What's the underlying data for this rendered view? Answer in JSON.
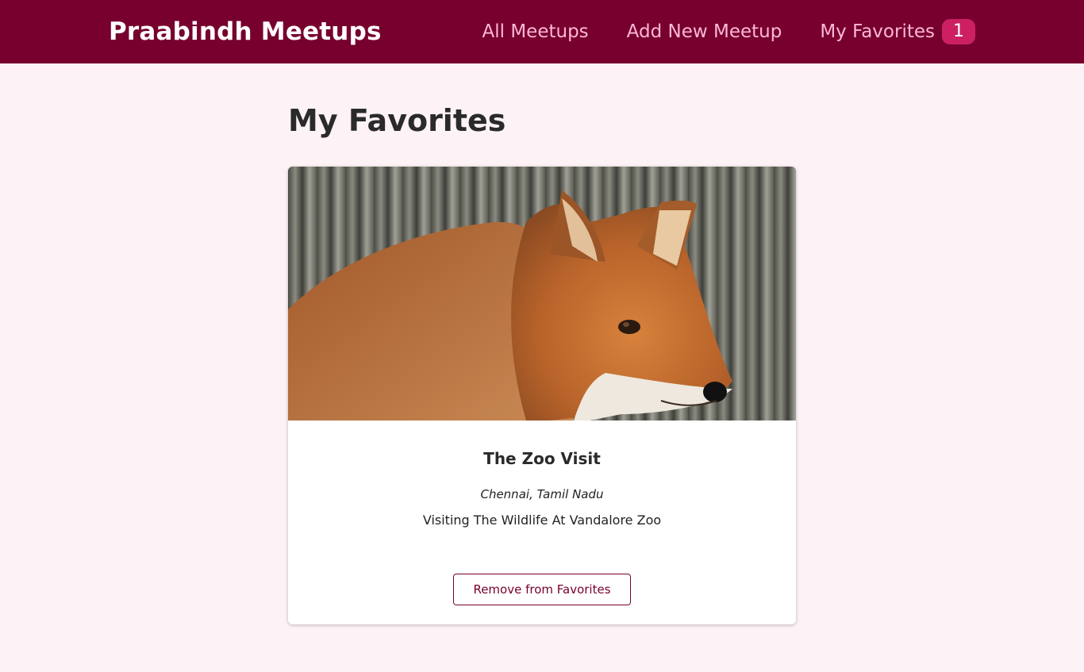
{
  "header": {
    "logo": "Praabindh Meetups",
    "nav": [
      {
        "label": "All Meetups"
      },
      {
        "label": "Add New Meetup"
      },
      {
        "label": "My Favorites",
        "badge": "1"
      }
    ]
  },
  "page": {
    "title": "My Favorites"
  },
  "meetups": [
    {
      "title": "The Zoo Visit",
      "address": "Chennai, Tamil Nadu",
      "description": "Visiting The Wildlife At Vandalore Zoo",
      "button_label": "Remove from Favorites"
    }
  ],
  "colors": {
    "header_bg": "#77002e",
    "nav_text": "#fcb8d2",
    "badge_bg": "#cc2062",
    "page_bg": "#fdf2f6"
  }
}
